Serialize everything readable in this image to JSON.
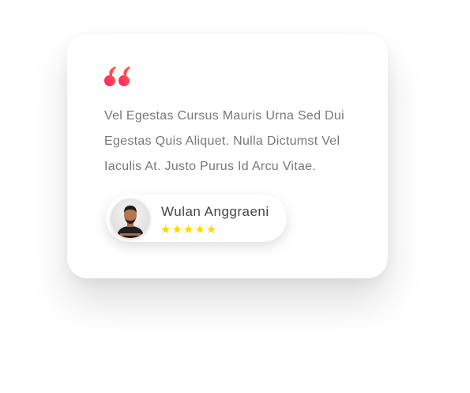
{
  "testimonial": {
    "quote_icon": "quote-open-icon",
    "text": "Vel Egestas Cursus Mauris Urna Sed Dui Egestas Quis Aliquet. Nulla Dictumst Vel Iaculis At. Justo Purus Id Arcu Vitae.",
    "author": "Wulan Anggraeni",
    "rating": 5,
    "stars": "★★★★★",
    "colors": {
      "quote_gradient": [
        "#ff1f6b",
        "#ff6a3d"
      ],
      "star": "#ffd600"
    }
  }
}
